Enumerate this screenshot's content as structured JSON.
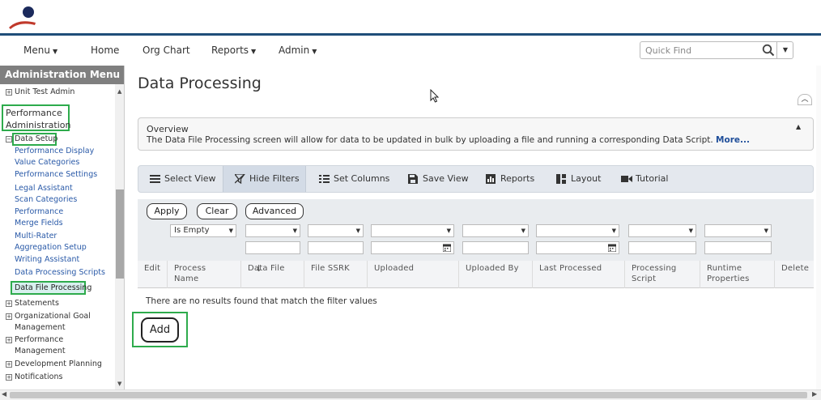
{
  "nav": {
    "menu": "Menu",
    "home": "Home",
    "org_chart": "Org Chart",
    "reports": "Reports",
    "admin": "Admin",
    "quick_find_placeholder": "Quick Find"
  },
  "sidebar": {
    "title": "Administration Menu",
    "items": [
      {
        "label": "Unit Test Admin",
        "icon": "plus-expand"
      },
      {
        "label": "Performance Administration",
        "highlighted": true
      },
      {
        "label": "Data Setup",
        "icon": "minus-collapse",
        "highlighted": true
      },
      {
        "label": "Performance Display Value Categories"
      },
      {
        "label": "Performance Settings"
      },
      {
        "label": "Legal Assistant Scan Categories"
      },
      {
        "label": "Performance Merge Fields"
      },
      {
        "label": "Multi-Rater Aggregation Setup"
      },
      {
        "label": "Writing Assistant"
      },
      {
        "label": "Data Processing Scripts"
      },
      {
        "label": "Data File Processing",
        "selected": true,
        "highlighted": true
      },
      {
        "label": "Statements",
        "icon": "plus-expand"
      },
      {
        "label": "Organizational Goal Management",
        "icon": "plus-expand"
      },
      {
        "label": "Performance Management",
        "icon": "plus-expand"
      },
      {
        "label": "Development Planning",
        "icon": "plus-expand"
      },
      {
        "label": "Notifications",
        "icon": "plus-expand"
      }
    ]
  },
  "page": {
    "title": "Data Processing"
  },
  "overview": {
    "title": "Overview",
    "text": "The Data File Processing screen will allow for data to be updated in bulk by uploading a file and running a corresponding Data Script.",
    "more": "More..."
  },
  "toolbar": {
    "select_view": "Select View",
    "hide_filters": "Hide Filters",
    "set_columns": "Set Columns",
    "save_view": "Save View",
    "reports": "Reports",
    "layout": "Layout",
    "tutorial": "Tutorial"
  },
  "filters": {
    "apply": "Apply",
    "clear": "Clear",
    "advanced": "Advanced",
    "process_name_operator": "Is Empty"
  },
  "table": {
    "columns": [
      "Edit",
      "Process Name",
      "Data File",
      "File SSRK",
      "Uploaded",
      "Uploaded By",
      "Last Processed",
      "Processing Script",
      "Runtime Properties",
      "Delete"
    ],
    "empty_message": "There are no results found that match the filter values"
  },
  "actions": {
    "add": "Add"
  },
  "colors": {
    "header_rule": "#1f4e79",
    "highlight": "#2eab4c",
    "link": "#2a5aa8"
  }
}
